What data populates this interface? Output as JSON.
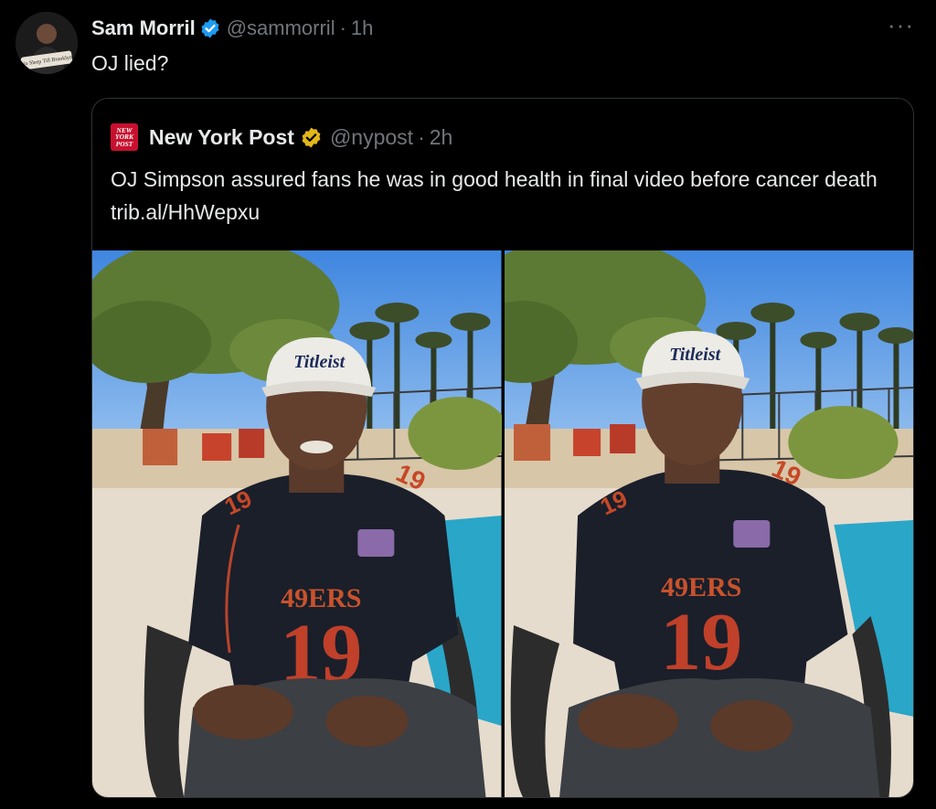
{
  "tweet": {
    "author_name": "Sam Morril",
    "author_handle": "@sammorril",
    "separator": "·",
    "time": "1h",
    "text": "OJ lied?",
    "more_icon": "more-horizontal-icon",
    "avatar_icon": "user-avatar",
    "avatar_text": "No Sleep Till Brooklyn"
  },
  "quote": {
    "author_name": "New York Post",
    "author_handle": "@nypost",
    "separator": "·",
    "time": "2h",
    "logo_lines": [
      "NEW",
      "YORK",
      "POST"
    ],
    "text": "OJ Simpson assured fans he was in good health in final video before cancer death trib.al/HhWepxu",
    "media": [
      {
        "cap_text": "Titleist",
        "jersey_text": "49ERS",
        "number": "19",
        "sleeve_number": "19"
      },
      {
        "cap_text": "Titleist",
        "jersey_text": "49ERS",
        "number": "19",
        "sleeve_number": "19"
      }
    ]
  },
  "colors": {
    "background": "#000000",
    "text": "#e7e9ea",
    "muted": "#71767b",
    "verified_blue": "#1d9bf0",
    "verified_gold": "#e2b719",
    "nypost_red": "#c8102e"
  }
}
